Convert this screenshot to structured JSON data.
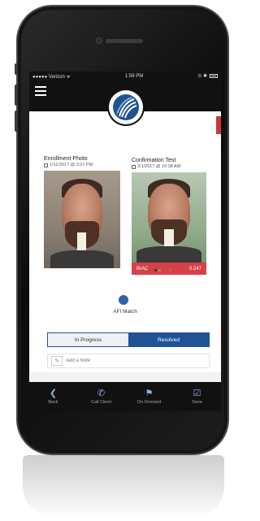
{
  "status_bar": {
    "carrier": "●●●●● Verizon ᯤ",
    "time": "1:56 PM",
    "right_icons": "⊙ ✱"
  },
  "header": {
    "menu_icon": "hamburger-menu-icon",
    "logo_icon": "company-logo-icon"
  },
  "enrollment": {
    "title": "Enrollment Photo",
    "date": "1/11/2017 @ 3:21 PM"
  },
  "confirmation": {
    "title": "Confirmation Test",
    "date": "2/1/2017 @ 10:38 AM",
    "brac_label": "BrAC",
    "brac_value": "0.247"
  },
  "pager": {
    "prev": "‹",
    "next": "›"
  },
  "match": {
    "label": "AFI Match"
  },
  "segmented": {
    "in_progress": "In Progress",
    "resolved": "Resolved",
    "selected": "Resolved"
  },
  "note": {
    "placeholder": "Add a Note"
  },
  "toolbar": {
    "back": "Back",
    "call_client": "Call Client",
    "on_demand": "On Demand",
    "save": "Save"
  },
  "colors": {
    "accent_blue": "#1f5393",
    "brac_red": "#d54147",
    "bar_black": "#111111"
  }
}
